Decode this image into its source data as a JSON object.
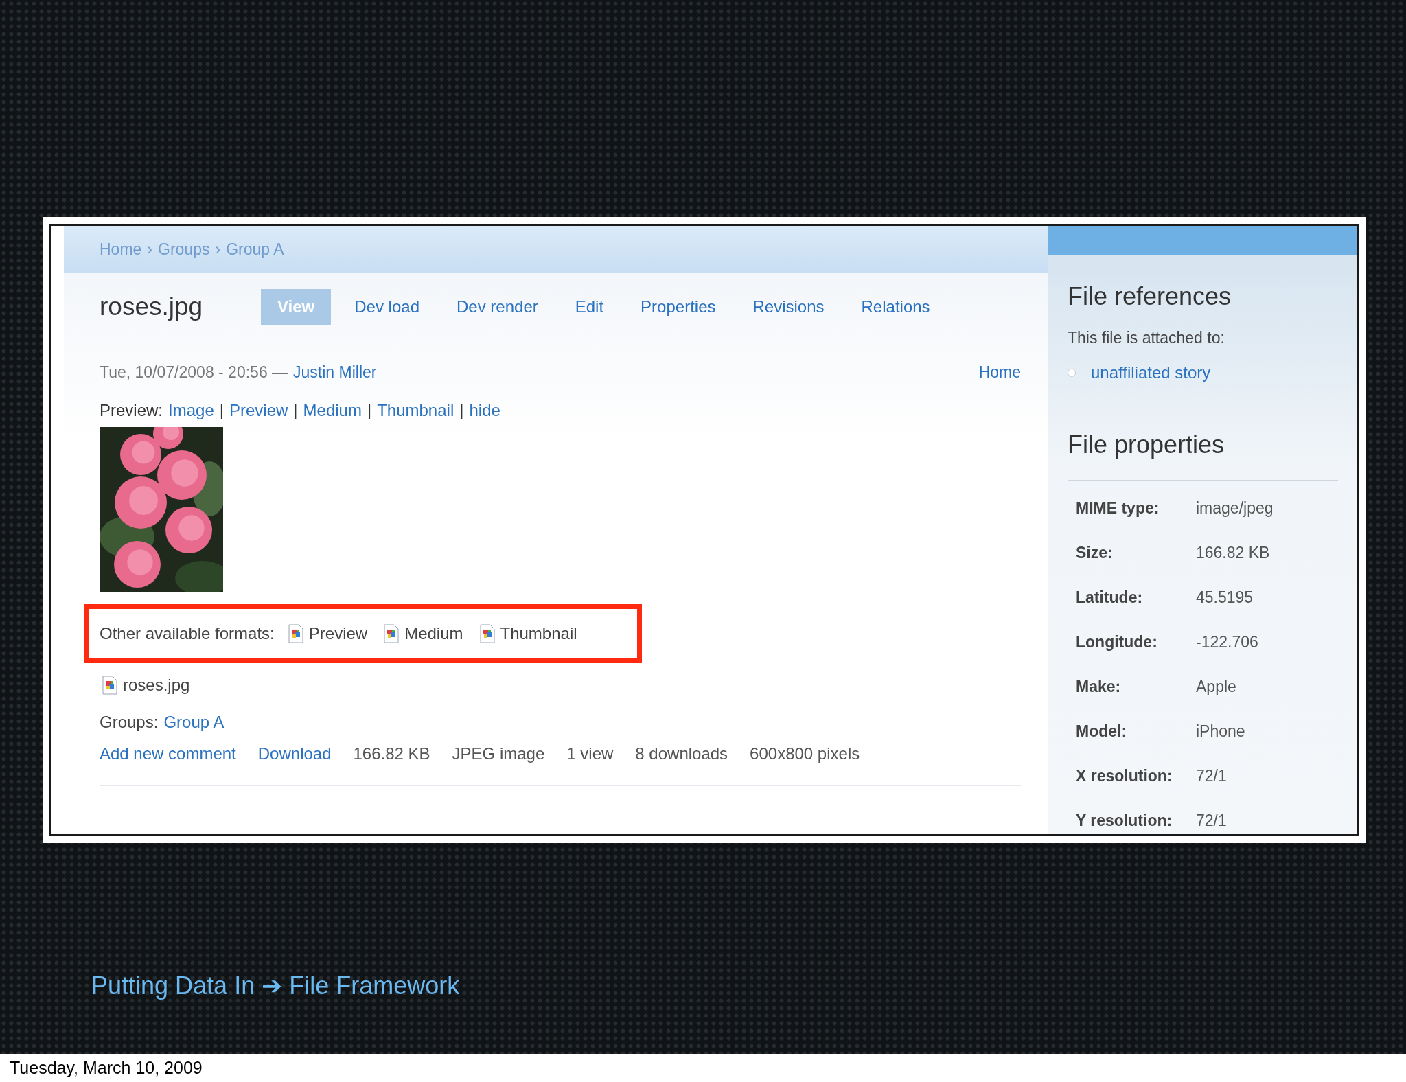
{
  "breadcrumb": {
    "separator": "›",
    "items": [
      "Home",
      "Groups",
      "Group A"
    ]
  },
  "title": "roses.jpg",
  "tabs": [
    {
      "label": "View",
      "selected": true
    },
    {
      "label": "Dev load",
      "selected": false
    },
    {
      "label": "Dev render",
      "selected": false
    },
    {
      "label": "Edit",
      "selected": false
    },
    {
      "label": "Properties",
      "selected": false
    },
    {
      "label": "Revisions",
      "selected": false
    },
    {
      "label": "Relations",
      "selected": false
    }
  ],
  "meta": {
    "date": "Tue, 10/07/2008 - 20:56 —",
    "author": "Justin Miller",
    "home_link": "Home"
  },
  "preview": {
    "label": "Preview:",
    "separator": "|",
    "links": [
      "Image",
      "Preview",
      "Medium",
      "Thumbnail",
      "hide"
    ]
  },
  "other_formats": {
    "label": "Other available formats:",
    "highlighted": true,
    "items": [
      "Preview",
      "Medium",
      "Thumbnail"
    ]
  },
  "file_link": "roses.jpg",
  "groups": {
    "label": "Groups:",
    "link": "Group A"
  },
  "info_row": [
    {
      "kind": "link",
      "text": "Add new comment"
    },
    {
      "kind": "link",
      "text": "Download"
    },
    {
      "kind": "text",
      "text": "166.82 KB"
    },
    {
      "kind": "text",
      "text": "JPEG image"
    },
    {
      "kind": "text",
      "text": "1 view"
    },
    {
      "kind": "text",
      "text": "8 downloads"
    },
    {
      "kind": "text",
      "text": "600x800 pixels"
    }
  ],
  "sidebar": {
    "references": {
      "title": "File references",
      "intro": "This file is attached to:",
      "items": [
        "unaffiliated story"
      ]
    },
    "properties": {
      "title": "File properties",
      "rows": [
        {
          "label": "MIME type:",
          "value": "image/jpeg"
        },
        {
          "label": "Size:",
          "value": "166.82 KB"
        },
        {
          "label": "Latitude:",
          "value": "45.5195"
        },
        {
          "label": "Longitude:",
          "value": "-122.706"
        },
        {
          "label": "Make:",
          "value": "Apple"
        },
        {
          "label": "Model:",
          "value": "iPhone"
        },
        {
          "label": "X resolution:",
          "value": "72/1"
        },
        {
          "label": "Y resolution:",
          "value": "72/1"
        }
      ]
    }
  },
  "slide": {
    "caption": "Putting Data In ➔ File Framework",
    "footer_date": "Tuesday, March 10, 2009"
  }
}
